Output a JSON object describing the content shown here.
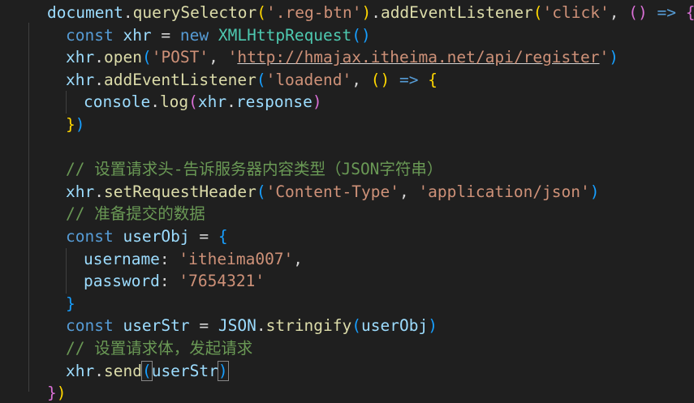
{
  "colors": {
    "background": "#1f1f1f",
    "keyword": "#569cd6",
    "variable": "#9cdcfe",
    "function": "#dcdcaa",
    "string": "#ce9178",
    "class": "#4ec9b0",
    "comment": "#6a9955",
    "bracket_level_1": "#ffd700",
    "bracket_level_2": "#da70d6",
    "bracket_level_3": "#179fff"
  },
  "lines": [
    {
      "id": "l1",
      "tokens": [
        {
          "t": "document",
          "c": "var"
        },
        {
          "t": ".",
          "c": "pl"
        },
        {
          "t": "querySelector",
          "c": "fn"
        },
        {
          "t": "(",
          "c": "p1"
        },
        {
          "t": "'.reg-btn'",
          "c": "str"
        },
        {
          "t": ")",
          "c": "p1"
        },
        {
          "t": ".",
          "c": "pl"
        },
        {
          "t": "addEventListener",
          "c": "fn"
        },
        {
          "t": "(",
          "c": "p1"
        },
        {
          "t": "'click'",
          "c": "str"
        },
        {
          "t": ", ",
          "c": "pl"
        },
        {
          "t": "()",
          "c": "p2"
        },
        {
          "t": " ",
          "c": "pl"
        },
        {
          "t": "=>",
          "c": "kw"
        },
        {
          "t": " ",
          "c": "pl"
        },
        {
          "t": "{",
          "c": "p2"
        }
      ]
    },
    {
      "id": "l2",
      "tokens": [
        {
          "t": "const",
          "c": "kw"
        },
        {
          "t": " ",
          "c": "pl"
        },
        {
          "t": "xhr",
          "c": "var"
        },
        {
          "t": " = ",
          "c": "pl"
        },
        {
          "t": "new",
          "c": "kw"
        },
        {
          "t": " ",
          "c": "pl"
        },
        {
          "t": "XMLHttpRequest",
          "c": "cls"
        },
        {
          "t": "()",
          "c": "p3"
        }
      ]
    },
    {
      "id": "l3",
      "tokens": [
        {
          "t": "xhr",
          "c": "var"
        },
        {
          "t": ".",
          "c": "pl"
        },
        {
          "t": "open",
          "c": "fn"
        },
        {
          "t": "(",
          "c": "p3"
        },
        {
          "t": "'POST'",
          "c": "str"
        },
        {
          "t": ", ",
          "c": "pl"
        },
        {
          "t": "'",
          "c": "str"
        },
        {
          "t": "http://hmajax.itheima.net/api/register",
          "c": "str ul"
        },
        {
          "t": "'",
          "c": "str"
        },
        {
          "t": ")",
          "c": "p3"
        }
      ]
    },
    {
      "id": "l4",
      "tokens": [
        {
          "t": "xhr",
          "c": "var"
        },
        {
          "t": ".",
          "c": "pl"
        },
        {
          "t": "addEventListener",
          "c": "fn"
        },
        {
          "t": "(",
          "c": "p3"
        },
        {
          "t": "'loadend'",
          "c": "str"
        },
        {
          "t": ", ",
          "c": "pl"
        },
        {
          "t": "()",
          "c": "p1"
        },
        {
          "t": " ",
          "c": "pl"
        },
        {
          "t": "=>",
          "c": "kw"
        },
        {
          "t": " ",
          "c": "pl"
        },
        {
          "t": "{",
          "c": "p1"
        }
      ]
    },
    {
      "id": "l5",
      "tokens": [
        {
          "t": "console",
          "c": "var"
        },
        {
          "t": ".",
          "c": "pl"
        },
        {
          "t": "log",
          "c": "fn"
        },
        {
          "t": "(",
          "c": "p2"
        },
        {
          "t": "xhr",
          "c": "var"
        },
        {
          "t": ".",
          "c": "pl"
        },
        {
          "t": "response",
          "c": "var"
        },
        {
          "t": ")",
          "c": "p2"
        }
      ]
    },
    {
      "id": "l6",
      "tokens": [
        {
          "t": "}",
          "c": "p1"
        },
        {
          "t": ")",
          "c": "p3"
        }
      ]
    },
    {
      "id": "l7",
      "tokens": []
    },
    {
      "id": "l8",
      "tokens": [
        {
          "t": "// 设置请求头-告诉服务器内容类型（JSON字符串）",
          "c": "cm"
        }
      ]
    },
    {
      "id": "l9",
      "tokens": [
        {
          "t": "xhr",
          "c": "var"
        },
        {
          "t": ".",
          "c": "pl"
        },
        {
          "t": "setRequestHeader",
          "c": "fn"
        },
        {
          "t": "(",
          "c": "p3"
        },
        {
          "t": "'Content-Type'",
          "c": "str"
        },
        {
          "t": ", ",
          "c": "pl"
        },
        {
          "t": "'application/json'",
          "c": "str"
        },
        {
          "t": ")",
          "c": "p3"
        }
      ]
    },
    {
      "id": "l10",
      "tokens": [
        {
          "t": "// 准备提交的数据",
          "c": "cm"
        }
      ]
    },
    {
      "id": "l11",
      "tokens": [
        {
          "t": "const",
          "c": "kw"
        },
        {
          "t": " ",
          "c": "pl"
        },
        {
          "t": "userObj",
          "c": "var"
        },
        {
          "t": " = ",
          "c": "pl"
        },
        {
          "t": "{",
          "c": "p3"
        }
      ]
    },
    {
      "id": "l12",
      "tokens": [
        {
          "t": "username",
          "c": "var"
        },
        {
          "t": ": ",
          "c": "pl"
        },
        {
          "t": "'itheima007'",
          "c": "str"
        },
        {
          "t": ",",
          "c": "pl"
        }
      ]
    },
    {
      "id": "l13",
      "tokens": [
        {
          "t": "password",
          "c": "var"
        },
        {
          "t": ": ",
          "c": "pl"
        },
        {
          "t": "'7654321'",
          "c": "str"
        }
      ]
    },
    {
      "id": "l14",
      "tokens": [
        {
          "t": "}",
          "c": "p3"
        }
      ]
    },
    {
      "id": "l15",
      "tokens": [
        {
          "t": "const",
          "c": "kw"
        },
        {
          "t": " ",
          "c": "pl"
        },
        {
          "t": "userStr",
          "c": "var"
        },
        {
          "t": " = ",
          "c": "pl"
        },
        {
          "t": "JSON",
          "c": "var"
        },
        {
          "t": ".",
          "c": "pl"
        },
        {
          "t": "stringify",
          "c": "fn"
        },
        {
          "t": "(",
          "c": "p3"
        },
        {
          "t": "userObj",
          "c": "var"
        },
        {
          "t": ")",
          "c": "p3"
        }
      ]
    },
    {
      "id": "l16",
      "tokens": [
        {
          "t": "// 设置请求体，发起请求",
          "c": "cm"
        }
      ]
    },
    {
      "id": "l17",
      "tokens": [
        {
          "t": "xhr",
          "c": "var"
        },
        {
          "t": ".",
          "c": "pl"
        },
        {
          "t": "send",
          "c": "fn"
        },
        {
          "t": "(",
          "c": "p3 bm"
        },
        {
          "t": "userStr",
          "c": "var"
        },
        {
          "t": ")",
          "c": "p3 bm"
        }
      ]
    },
    {
      "id": "l18",
      "tokens": [
        {
          "t": "}",
          "c": "p2"
        },
        {
          "t": ")",
          "c": "p1"
        }
      ]
    }
  ]
}
